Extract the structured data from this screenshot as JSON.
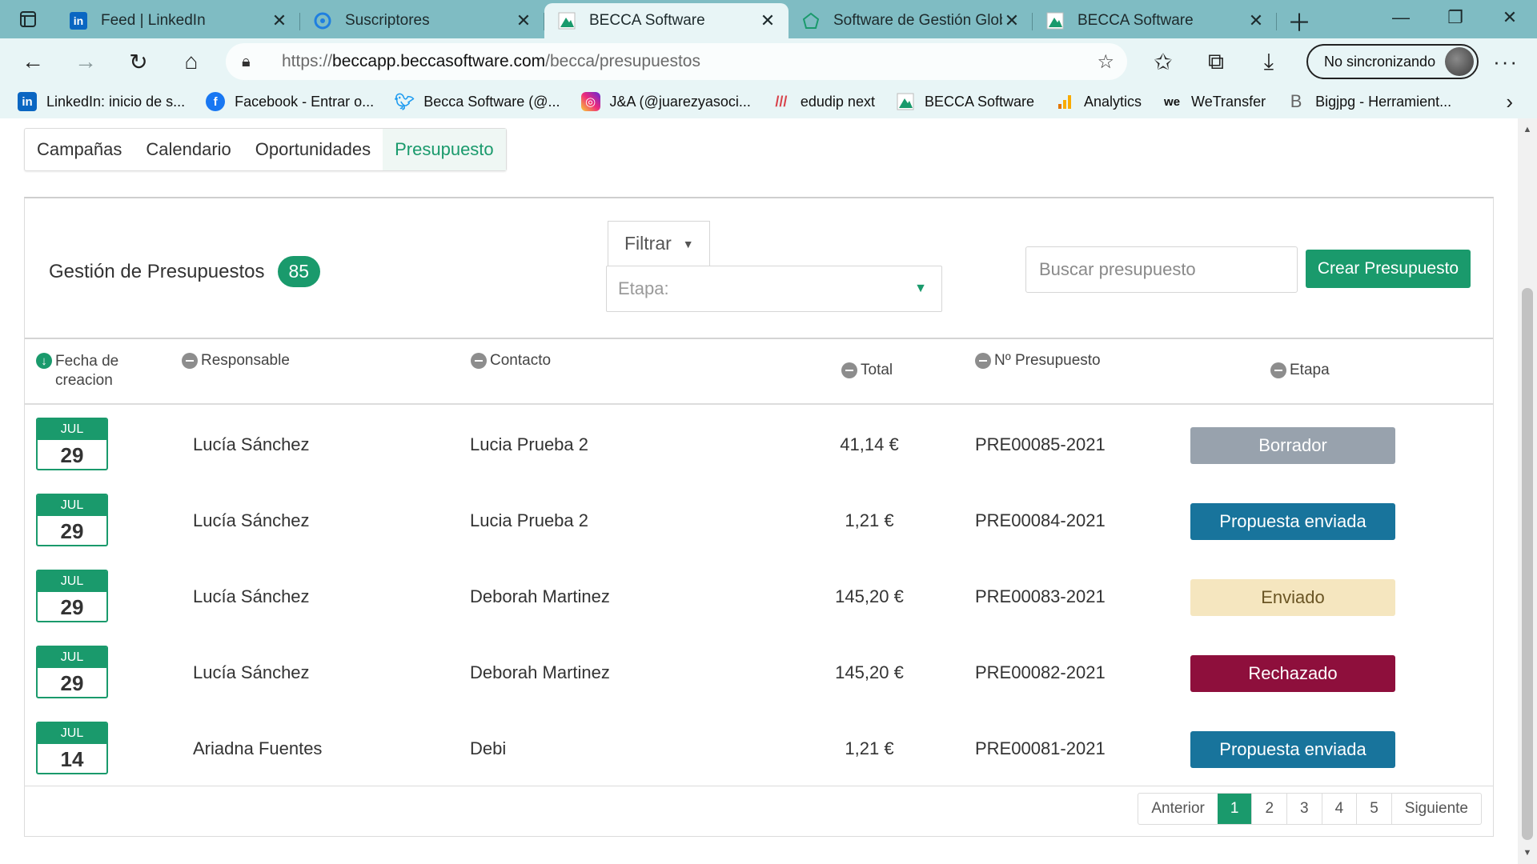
{
  "browser": {
    "tabs": [
      {
        "title": "Feed | LinkedIn",
        "icon": "linkedin-icon",
        "active": false
      },
      {
        "title": "Suscriptores",
        "icon": "sendinblue-icon",
        "active": false
      },
      {
        "title": "BECCA Software",
        "icon": "becca-icon",
        "active": true
      },
      {
        "title": "Software de Gestión Glob",
        "icon": "becca-web-icon",
        "active": false
      },
      {
        "title": "BECCA Software",
        "icon": "becca-icon",
        "active": false
      }
    ],
    "url": {
      "proto": "https://",
      "host": "beccapp.beccasoftware.com",
      "path": "/becca/presupuestos"
    },
    "profile_label": "No sincronizando",
    "bookmarks": [
      {
        "label": "LinkedIn: inicio de s...",
        "icon": "linkedin-icon",
        "color": "#0a66c2"
      },
      {
        "label": "Facebook - Entrar o...",
        "icon": "facebook-icon",
        "color": "#1877f2"
      },
      {
        "label": "Becca Software (@...",
        "icon": "twitter-icon",
        "color": "#1d9bf0"
      },
      {
        "label": "J&A (@juarezyasoci...",
        "icon": "instagram-icon",
        "color": "#d6249f"
      },
      {
        "label": "edudip next",
        "icon": "edudip-icon",
        "color": "#d8434b"
      },
      {
        "label": "BECCA Software",
        "icon": "becca-icon",
        "color": "#1a9a6c"
      },
      {
        "label": "Analytics",
        "icon": "analytics-icon",
        "color": "#f9ab00"
      },
      {
        "label": "WeTransfer",
        "icon": "wetransfer-icon",
        "color": "#111111"
      },
      {
        "label": "Bigjpg - Herramient...",
        "icon": "bigjpg-icon",
        "color": "#555555"
      }
    ]
  },
  "subnav": {
    "items": [
      "Campañas",
      "Calendario",
      "Oportunidades",
      "Presupuesto"
    ],
    "active": "Presupuesto"
  },
  "header": {
    "title": "Gestión de Presupuestos",
    "count": "85",
    "filter_label": "Filtrar",
    "stage_placeholder": "Etapa:",
    "search_placeholder": "Buscar presupuesto",
    "create_label": "Crear Presupuesto"
  },
  "table": {
    "columns": {
      "fecha": "Fecha de creacion",
      "responsable": "Responsable",
      "contacto": "Contacto",
      "total": "Total",
      "numero": "Nº Presupuesto",
      "etapa": "Etapa"
    },
    "rows": [
      {
        "month": "JUL",
        "day": "29",
        "responsable": "Lucía Sánchez",
        "contacto": "Lucia Prueba 2",
        "total": "41,14 €",
        "numero": "PRE00085-2021",
        "etapa": "Borrador",
        "etapa_bg": "#98a2ad",
        "etapa_fg": "#ffffff"
      },
      {
        "month": "JUL",
        "day": "29",
        "responsable": "Lucía Sánchez",
        "contacto": "Lucia Prueba 2",
        "total": "1,21 €",
        "numero": "PRE00084-2021",
        "etapa": "Propuesta enviada",
        "etapa_bg": "#18749c",
        "etapa_fg": "#ffffff"
      },
      {
        "month": "JUL",
        "day": "29",
        "responsable": "Lucía Sánchez",
        "contacto": "Deborah Martinez",
        "total": "145,20 €",
        "numero": "PRE00083-2021",
        "etapa": "Enviado",
        "etapa_bg": "#f5e6bf",
        "etapa_fg": "#6a5524"
      },
      {
        "month": "JUL",
        "day": "29",
        "responsable": "Lucía Sánchez",
        "contacto": "Deborah Martinez",
        "total": "145,20 €",
        "numero": "PRE00082-2021",
        "etapa": "Rechazado",
        "etapa_bg": "#8e0f3c",
        "etapa_fg": "#ffffff"
      },
      {
        "month": "JUL",
        "day": "14",
        "responsable": "Ariadna Fuentes",
        "contacto": "Debi",
        "total": "1,21 €",
        "numero": "PRE00081-2021",
        "etapa": "Propuesta enviada",
        "etapa_bg": "#18749c",
        "etapa_fg": "#ffffff"
      }
    ]
  },
  "pagination": {
    "prev": "Anterior",
    "pages": [
      "1",
      "2",
      "3",
      "4",
      "5"
    ],
    "current": "1",
    "next": "Siguiente"
  },
  "colors": {
    "accent": "#1a9a6c",
    "chrome": "#7fbcc3",
    "chrome_light": "#e8f5f6"
  }
}
